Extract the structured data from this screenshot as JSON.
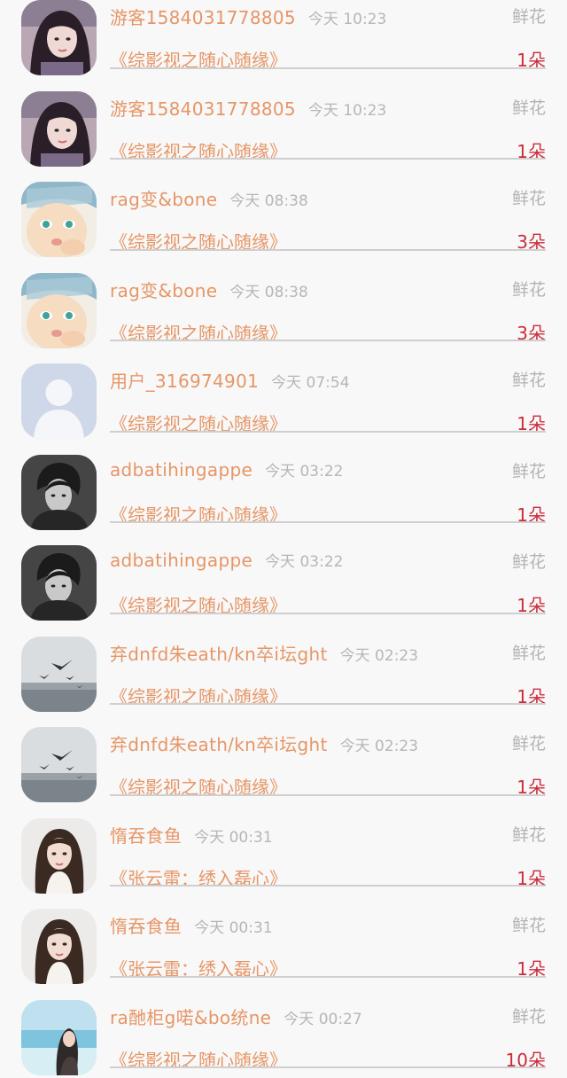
{
  "records": [
    {
      "name": "游客1584031778805",
      "time": "今天 10:23",
      "gift": "鲜花",
      "book": "《综影视之随心随缘》",
      "count": "1朵",
      "avatar": "girl-selfie-icon"
    },
    {
      "name": "游客1584031778805",
      "time": "今天 10:23",
      "gift": "鲜花",
      "book": "《综影视之随心随缘》",
      "count": "1朵",
      "avatar": "girl-selfie-icon"
    },
    {
      "name": "rag变&bone",
      "time": "今天 08:38",
      "gift": "鲜花",
      "book": "《综影视之随心随缘》",
      "count": "3朵",
      "avatar": "baby-face-icon"
    },
    {
      "name": "rag变&bone",
      "time": "今天 08:38",
      "gift": "鲜花",
      "book": "《综影视之随心随缘》",
      "count": "3朵",
      "avatar": "baby-face-icon"
    },
    {
      "name": "用户_316974901",
      "time": "今天 07:54",
      "gift": "鲜花",
      "book": "《综影视之随心随缘》",
      "count": "1朵",
      "avatar": "default-user-icon"
    },
    {
      "name": "adbatihingappe",
      "time": "今天 03:22",
      "gift": "鲜花",
      "book": "《综影视之随心随缘》",
      "count": "1朵",
      "avatar": "bw-portrait-icon"
    },
    {
      "name": "adbatihingappe",
      "time": "今天 03:22",
      "gift": "鲜花",
      "book": "《综影视之随心随缘》",
      "count": "1朵",
      "avatar": "bw-portrait-icon"
    },
    {
      "name": "弃dnfd朱eath/kn卒i坛ght",
      "time": "今天 02:23",
      "gift": "鲜花",
      "book": "《综影视之随心随缘》",
      "count": "1朵",
      "avatar": "birds-landscape-icon"
    },
    {
      "name": "弃dnfd朱eath/kn卒i坛ght",
      "time": "今天 02:23",
      "gift": "鲜花",
      "book": "《综影视之随心随缘》",
      "count": "1朵",
      "avatar": "birds-landscape-icon"
    },
    {
      "name": "惰吞食鱼",
      "time": "今天 00:31",
      "gift": "鲜花",
      "book": "《张云雷：绣入磊心》",
      "count": "1朵",
      "avatar": "long-hair-girl-icon"
    },
    {
      "name": "惰吞食鱼",
      "time": "今天 00:31",
      "gift": "鲜花",
      "book": "《张云雷：绣入磊心》",
      "count": "1朵",
      "avatar": "long-hair-girl-icon"
    },
    {
      "name": "ra酏柜g喏&bo统ne",
      "time": "今天 00:27",
      "gift": "鲜花",
      "book": "《综影视之随心随缘》",
      "count": "10朵",
      "avatar": "beach-girl-icon"
    }
  ]
}
